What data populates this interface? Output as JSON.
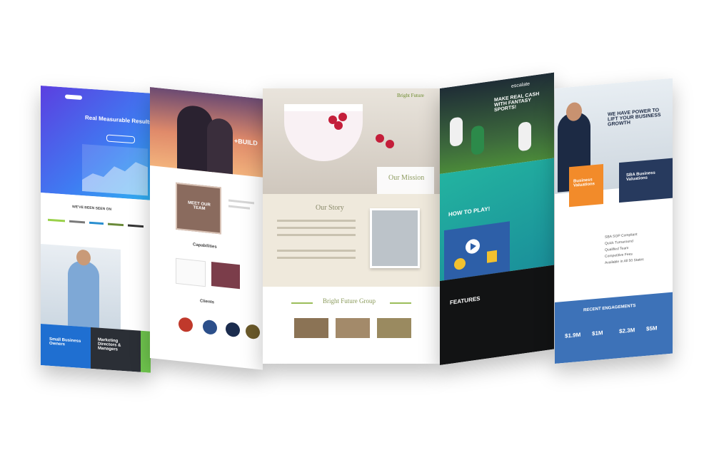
{
  "panel1": {
    "hero_title": "Real Measurable Results",
    "logos_heading": "WE'VE BEEN SEEN ON",
    "tiles": [
      "Small Business Owners",
      "Marketing Directors & Managers"
    ]
  },
  "panel2": {
    "brand": "+BUILD",
    "team_label": "MEET OUR TEAM",
    "capabilities_heading": "Capabilities",
    "clients_heading": "Clients"
  },
  "panel3": {
    "brand": "Bright Future",
    "mission": "Our Mission",
    "story": "Our Story",
    "group_heading": "Bright Future Group"
  },
  "panel4": {
    "logo": "escalate",
    "hero_text": "MAKE REAL CASH WITH FANTASY SPORTS!",
    "how_to_play": "HOW TO PLAY!",
    "features": "FEATURES"
  },
  "panel5": {
    "hero_text": "WE HAVE POWER TO LIFT YOUR BUSINESS GROWTH",
    "tile_orange": "Business Valuations",
    "tile_navy": "SBA Business Valuations",
    "list": [
      "SBA SOP Compliant",
      "Quick Turnaround",
      "Qualified Team",
      "Competitive Fees",
      "Available in All 50 States"
    ],
    "recent_heading": "RECENT ENGAGEMENTS",
    "stats": [
      "$1.9M",
      "$1M",
      "$2.3M",
      "$5M"
    ]
  }
}
